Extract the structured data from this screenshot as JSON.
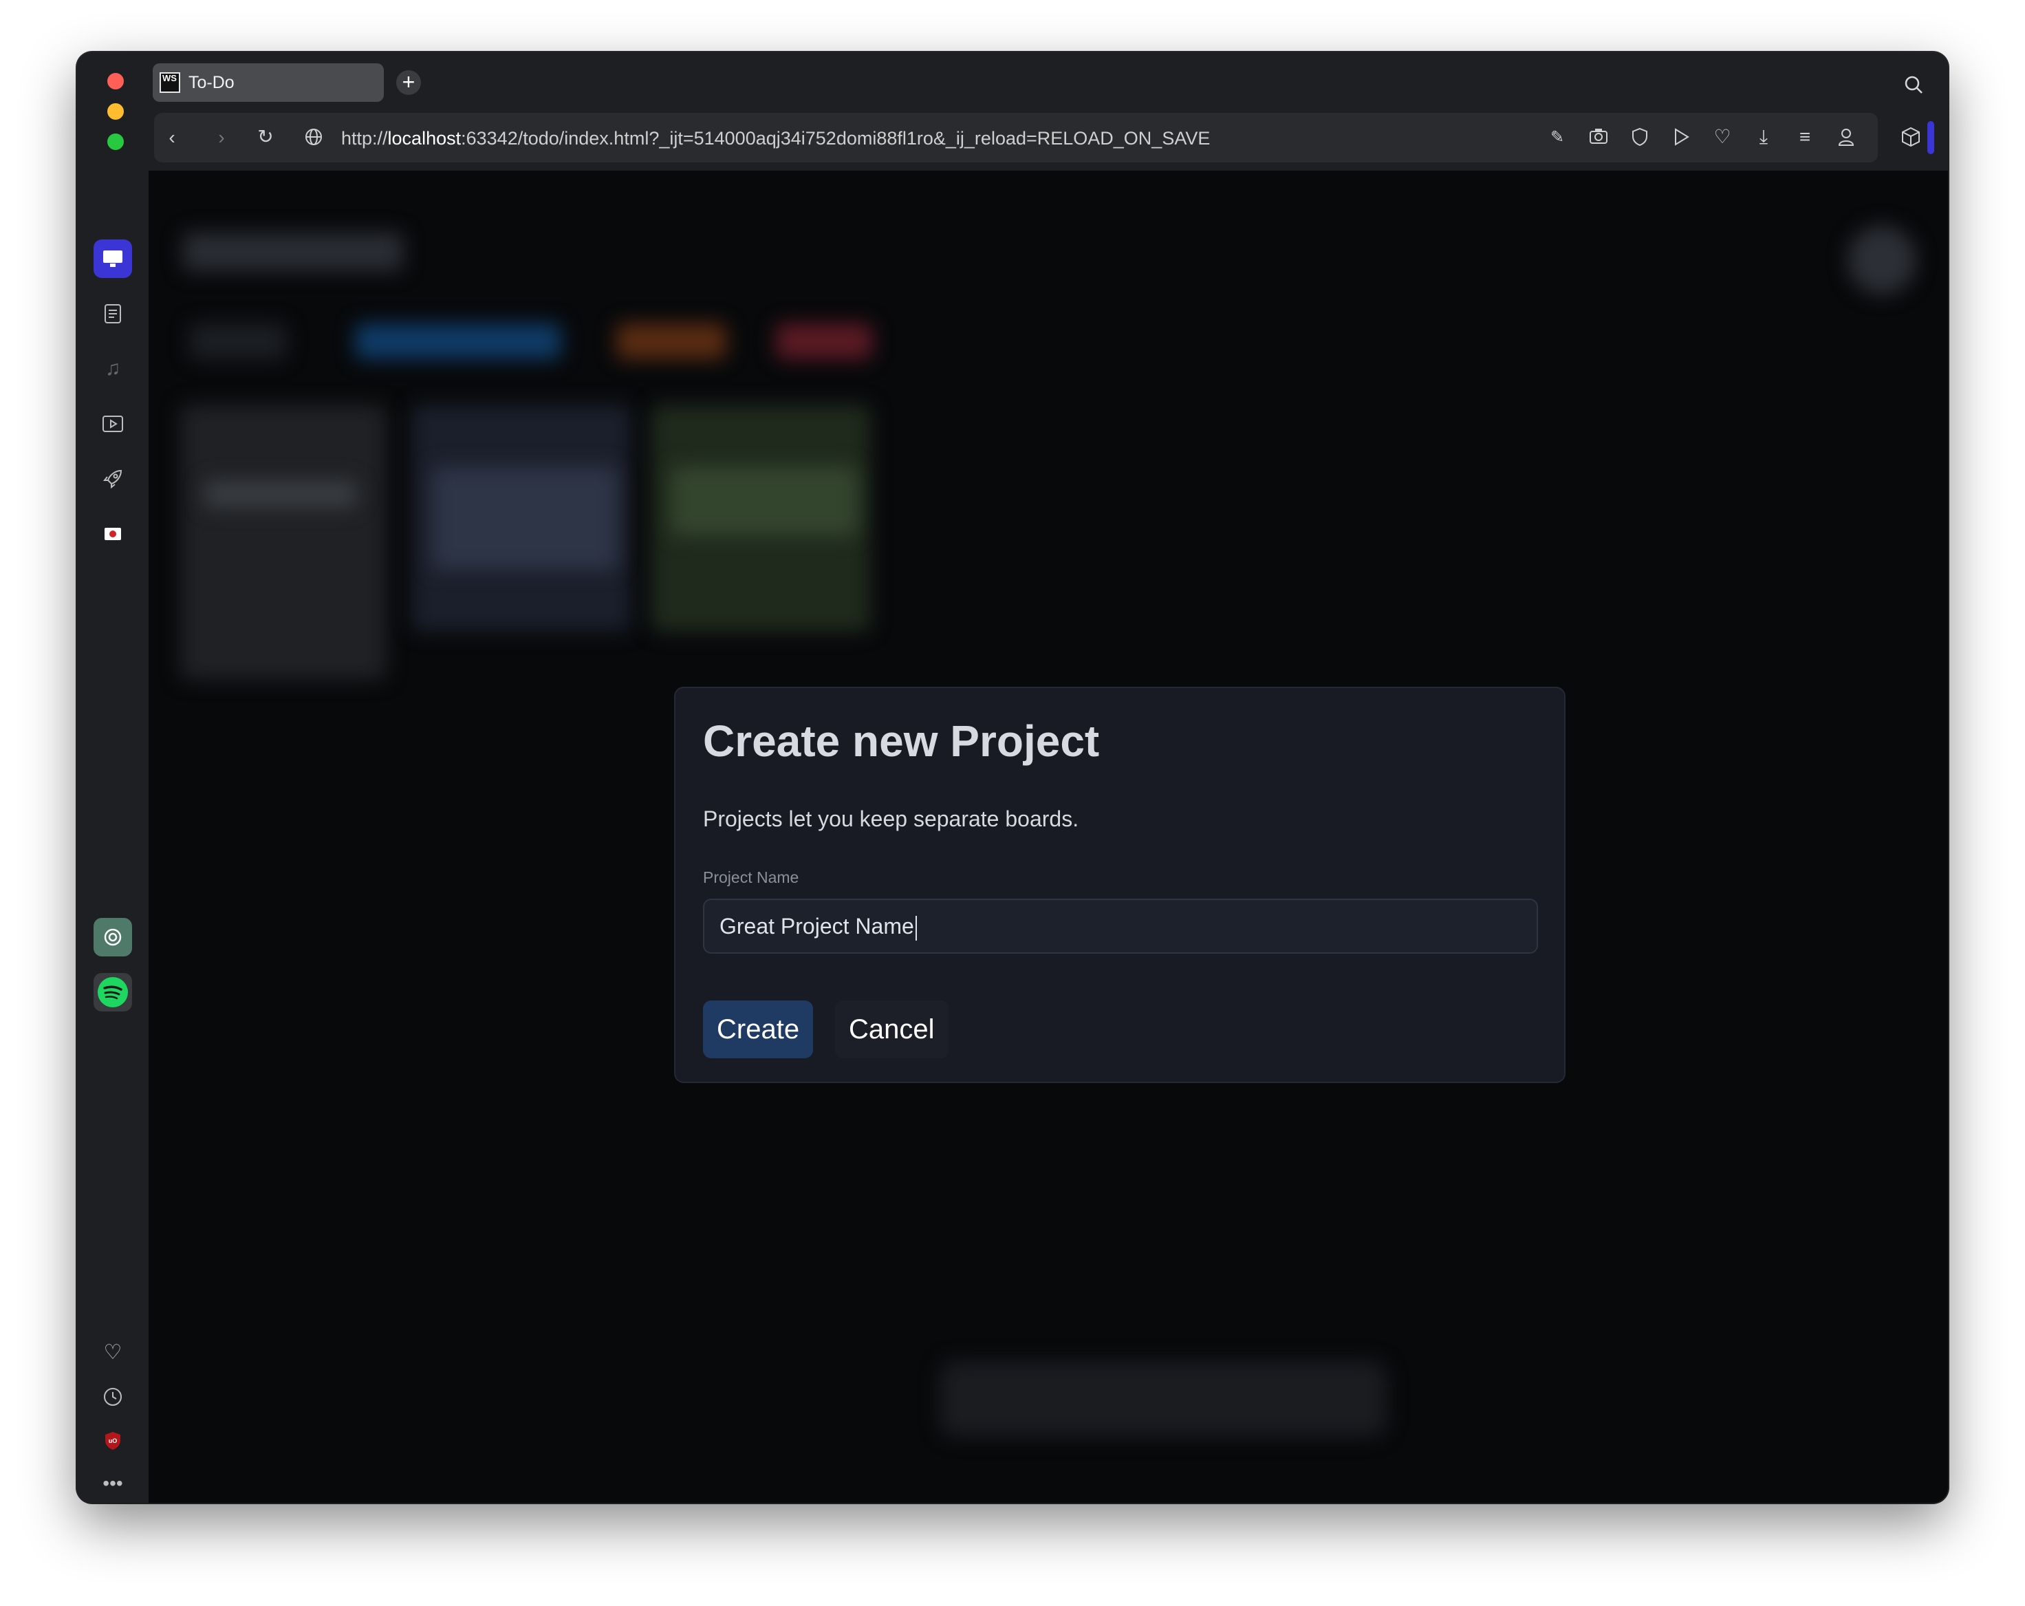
{
  "tab": {
    "favicon": "WS",
    "title": "To-Do"
  },
  "address": {
    "prefix": "http://",
    "host": "localhost",
    "rest": ":63342/todo/index.html?_ijt=514000aqj34i752domi88fl1ro&_ij_reload=RELOAD_ON_SAVE"
  },
  "toolbar_icons": [
    "edit-icon",
    "camera-icon",
    "shield-icon",
    "play-icon",
    "heart-icon",
    "download-icon",
    "menu-icon",
    "profile-icon",
    "cube-icon"
  ],
  "sidebar_icons": [
    "monitor-icon",
    "notes-icon",
    "music-icon",
    "video-icon",
    "rocket-icon",
    "flag-icon",
    "chatgpt-icon",
    "spotify-icon",
    "heart-icon",
    "clock-icon",
    "ublock-icon",
    "more-icon"
  ],
  "modal": {
    "title": "Create new Project",
    "description": "Projects let you keep separate boards.",
    "field_label": "Project Name",
    "field_value": "Great Project Name",
    "create_label": "Create",
    "cancel_label": "Cancel"
  },
  "colors": {
    "accent": "#3b35d6",
    "primary_button": "#1f3a63",
    "modal_bg": "#181b23",
    "page_bg": "#08090b"
  }
}
